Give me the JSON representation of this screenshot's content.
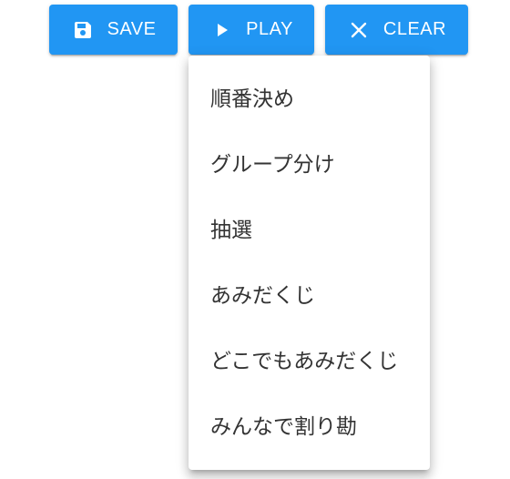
{
  "toolbar": {
    "save_label": "SAVE",
    "play_label": "PLAY",
    "clear_label": "CLEAR",
    "save_icon": "floppy-disk-icon",
    "play_icon": "play-icon",
    "clear_icon": "close-icon"
  },
  "play_menu": {
    "items": [
      {
        "label": "順番決め"
      },
      {
        "label": "グループ分け"
      },
      {
        "label": "抽選"
      },
      {
        "label": "あみだくじ"
      },
      {
        "label": "どこでもあみだくじ"
      },
      {
        "label": "みんなで割り勘"
      }
    ]
  },
  "colors": {
    "accent": "#2196f3",
    "menu_text": "#333333",
    "button_text": "#ffffff"
  }
}
